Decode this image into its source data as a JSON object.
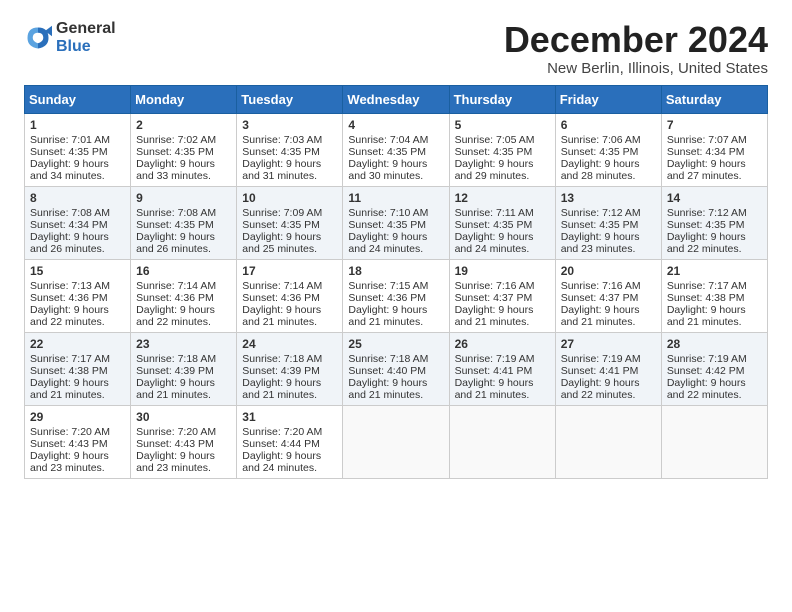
{
  "logo": {
    "general": "General",
    "blue": "Blue"
  },
  "title": {
    "month": "December 2024",
    "location": "New Berlin, Illinois, United States"
  },
  "days_of_week": [
    "Sunday",
    "Monday",
    "Tuesday",
    "Wednesday",
    "Thursday",
    "Friday",
    "Saturday"
  ],
  "weeks": [
    [
      {
        "num": "1",
        "sunrise": "7:01 AM",
        "sunset": "4:35 PM",
        "daylight": "9 hours and 34 minutes."
      },
      {
        "num": "2",
        "sunrise": "7:02 AM",
        "sunset": "4:35 PM",
        "daylight": "9 hours and 33 minutes."
      },
      {
        "num": "3",
        "sunrise": "7:03 AM",
        "sunset": "4:35 PM",
        "daylight": "9 hours and 31 minutes."
      },
      {
        "num": "4",
        "sunrise": "7:04 AM",
        "sunset": "4:35 PM",
        "daylight": "9 hours and 30 minutes."
      },
      {
        "num": "5",
        "sunrise": "7:05 AM",
        "sunset": "4:35 PM",
        "daylight": "9 hours and 29 minutes."
      },
      {
        "num": "6",
        "sunrise": "7:06 AM",
        "sunset": "4:35 PM",
        "daylight": "9 hours and 28 minutes."
      },
      {
        "num": "7",
        "sunrise": "7:07 AM",
        "sunset": "4:34 PM",
        "daylight": "9 hours and 27 minutes."
      }
    ],
    [
      {
        "num": "8",
        "sunrise": "7:08 AM",
        "sunset": "4:34 PM",
        "daylight": "9 hours and 26 minutes."
      },
      {
        "num": "9",
        "sunrise": "7:08 AM",
        "sunset": "4:35 PM",
        "daylight": "9 hours and 26 minutes."
      },
      {
        "num": "10",
        "sunrise": "7:09 AM",
        "sunset": "4:35 PM",
        "daylight": "9 hours and 25 minutes."
      },
      {
        "num": "11",
        "sunrise": "7:10 AM",
        "sunset": "4:35 PM",
        "daylight": "9 hours and 24 minutes."
      },
      {
        "num": "12",
        "sunrise": "7:11 AM",
        "sunset": "4:35 PM",
        "daylight": "9 hours and 24 minutes."
      },
      {
        "num": "13",
        "sunrise": "7:12 AM",
        "sunset": "4:35 PM",
        "daylight": "9 hours and 23 minutes."
      },
      {
        "num": "14",
        "sunrise": "7:12 AM",
        "sunset": "4:35 PM",
        "daylight": "9 hours and 22 minutes."
      }
    ],
    [
      {
        "num": "15",
        "sunrise": "7:13 AM",
        "sunset": "4:36 PM",
        "daylight": "9 hours and 22 minutes."
      },
      {
        "num": "16",
        "sunrise": "7:14 AM",
        "sunset": "4:36 PM",
        "daylight": "9 hours and 22 minutes."
      },
      {
        "num": "17",
        "sunrise": "7:14 AM",
        "sunset": "4:36 PM",
        "daylight": "9 hours and 21 minutes."
      },
      {
        "num": "18",
        "sunrise": "7:15 AM",
        "sunset": "4:36 PM",
        "daylight": "9 hours and 21 minutes."
      },
      {
        "num": "19",
        "sunrise": "7:16 AM",
        "sunset": "4:37 PM",
        "daylight": "9 hours and 21 minutes."
      },
      {
        "num": "20",
        "sunrise": "7:16 AM",
        "sunset": "4:37 PM",
        "daylight": "9 hours and 21 minutes."
      },
      {
        "num": "21",
        "sunrise": "7:17 AM",
        "sunset": "4:38 PM",
        "daylight": "9 hours and 21 minutes."
      }
    ],
    [
      {
        "num": "22",
        "sunrise": "7:17 AM",
        "sunset": "4:38 PM",
        "daylight": "9 hours and 21 minutes."
      },
      {
        "num": "23",
        "sunrise": "7:18 AM",
        "sunset": "4:39 PM",
        "daylight": "9 hours and 21 minutes."
      },
      {
        "num": "24",
        "sunrise": "7:18 AM",
        "sunset": "4:39 PM",
        "daylight": "9 hours and 21 minutes."
      },
      {
        "num": "25",
        "sunrise": "7:18 AM",
        "sunset": "4:40 PM",
        "daylight": "9 hours and 21 minutes."
      },
      {
        "num": "26",
        "sunrise": "7:19 AM",
        "sunset": "4:41 PM",
        "daylight": "9 hours and 21 minutes."
      },
      {
        "num": "27",
        "sunrise": "7:19 AM",
        "sunset": "4:41 PM",
        "daylight": "9 hours and 22 minutes."
      },
      {
        "num": "28",
        "sunrise": "7:19 AM",
        "sunset": "4:42 PM",
        "daylight": "9 hours and 22 minutes."
      }
    ],
    [
      {
        "num": "29",
        "sunrise": "7:20 AM",
        "sunset": "4:43 PM",
        "daylight": "9 hours and 23 minutes."
      },
      {
        "num": "30",
        "sunrise": "7:20 AM",
        "sunset": "4:43 PM",
        "daylight": "9 hours and 23 minutes."
      },
      {
        "num": "31",
        "sunrise": "7:20 AM",
        "sunset": "4:44 PM",
        "daylight": "9 hours and 24 minutes."
      },
      null,
      null,
      null,
      null
    ]
  ],
  "labels": {
    "sunrise": "Sunrise:",
    "sunset": "Sunset:",
    "daylight": "Daylight:"
  }
}
